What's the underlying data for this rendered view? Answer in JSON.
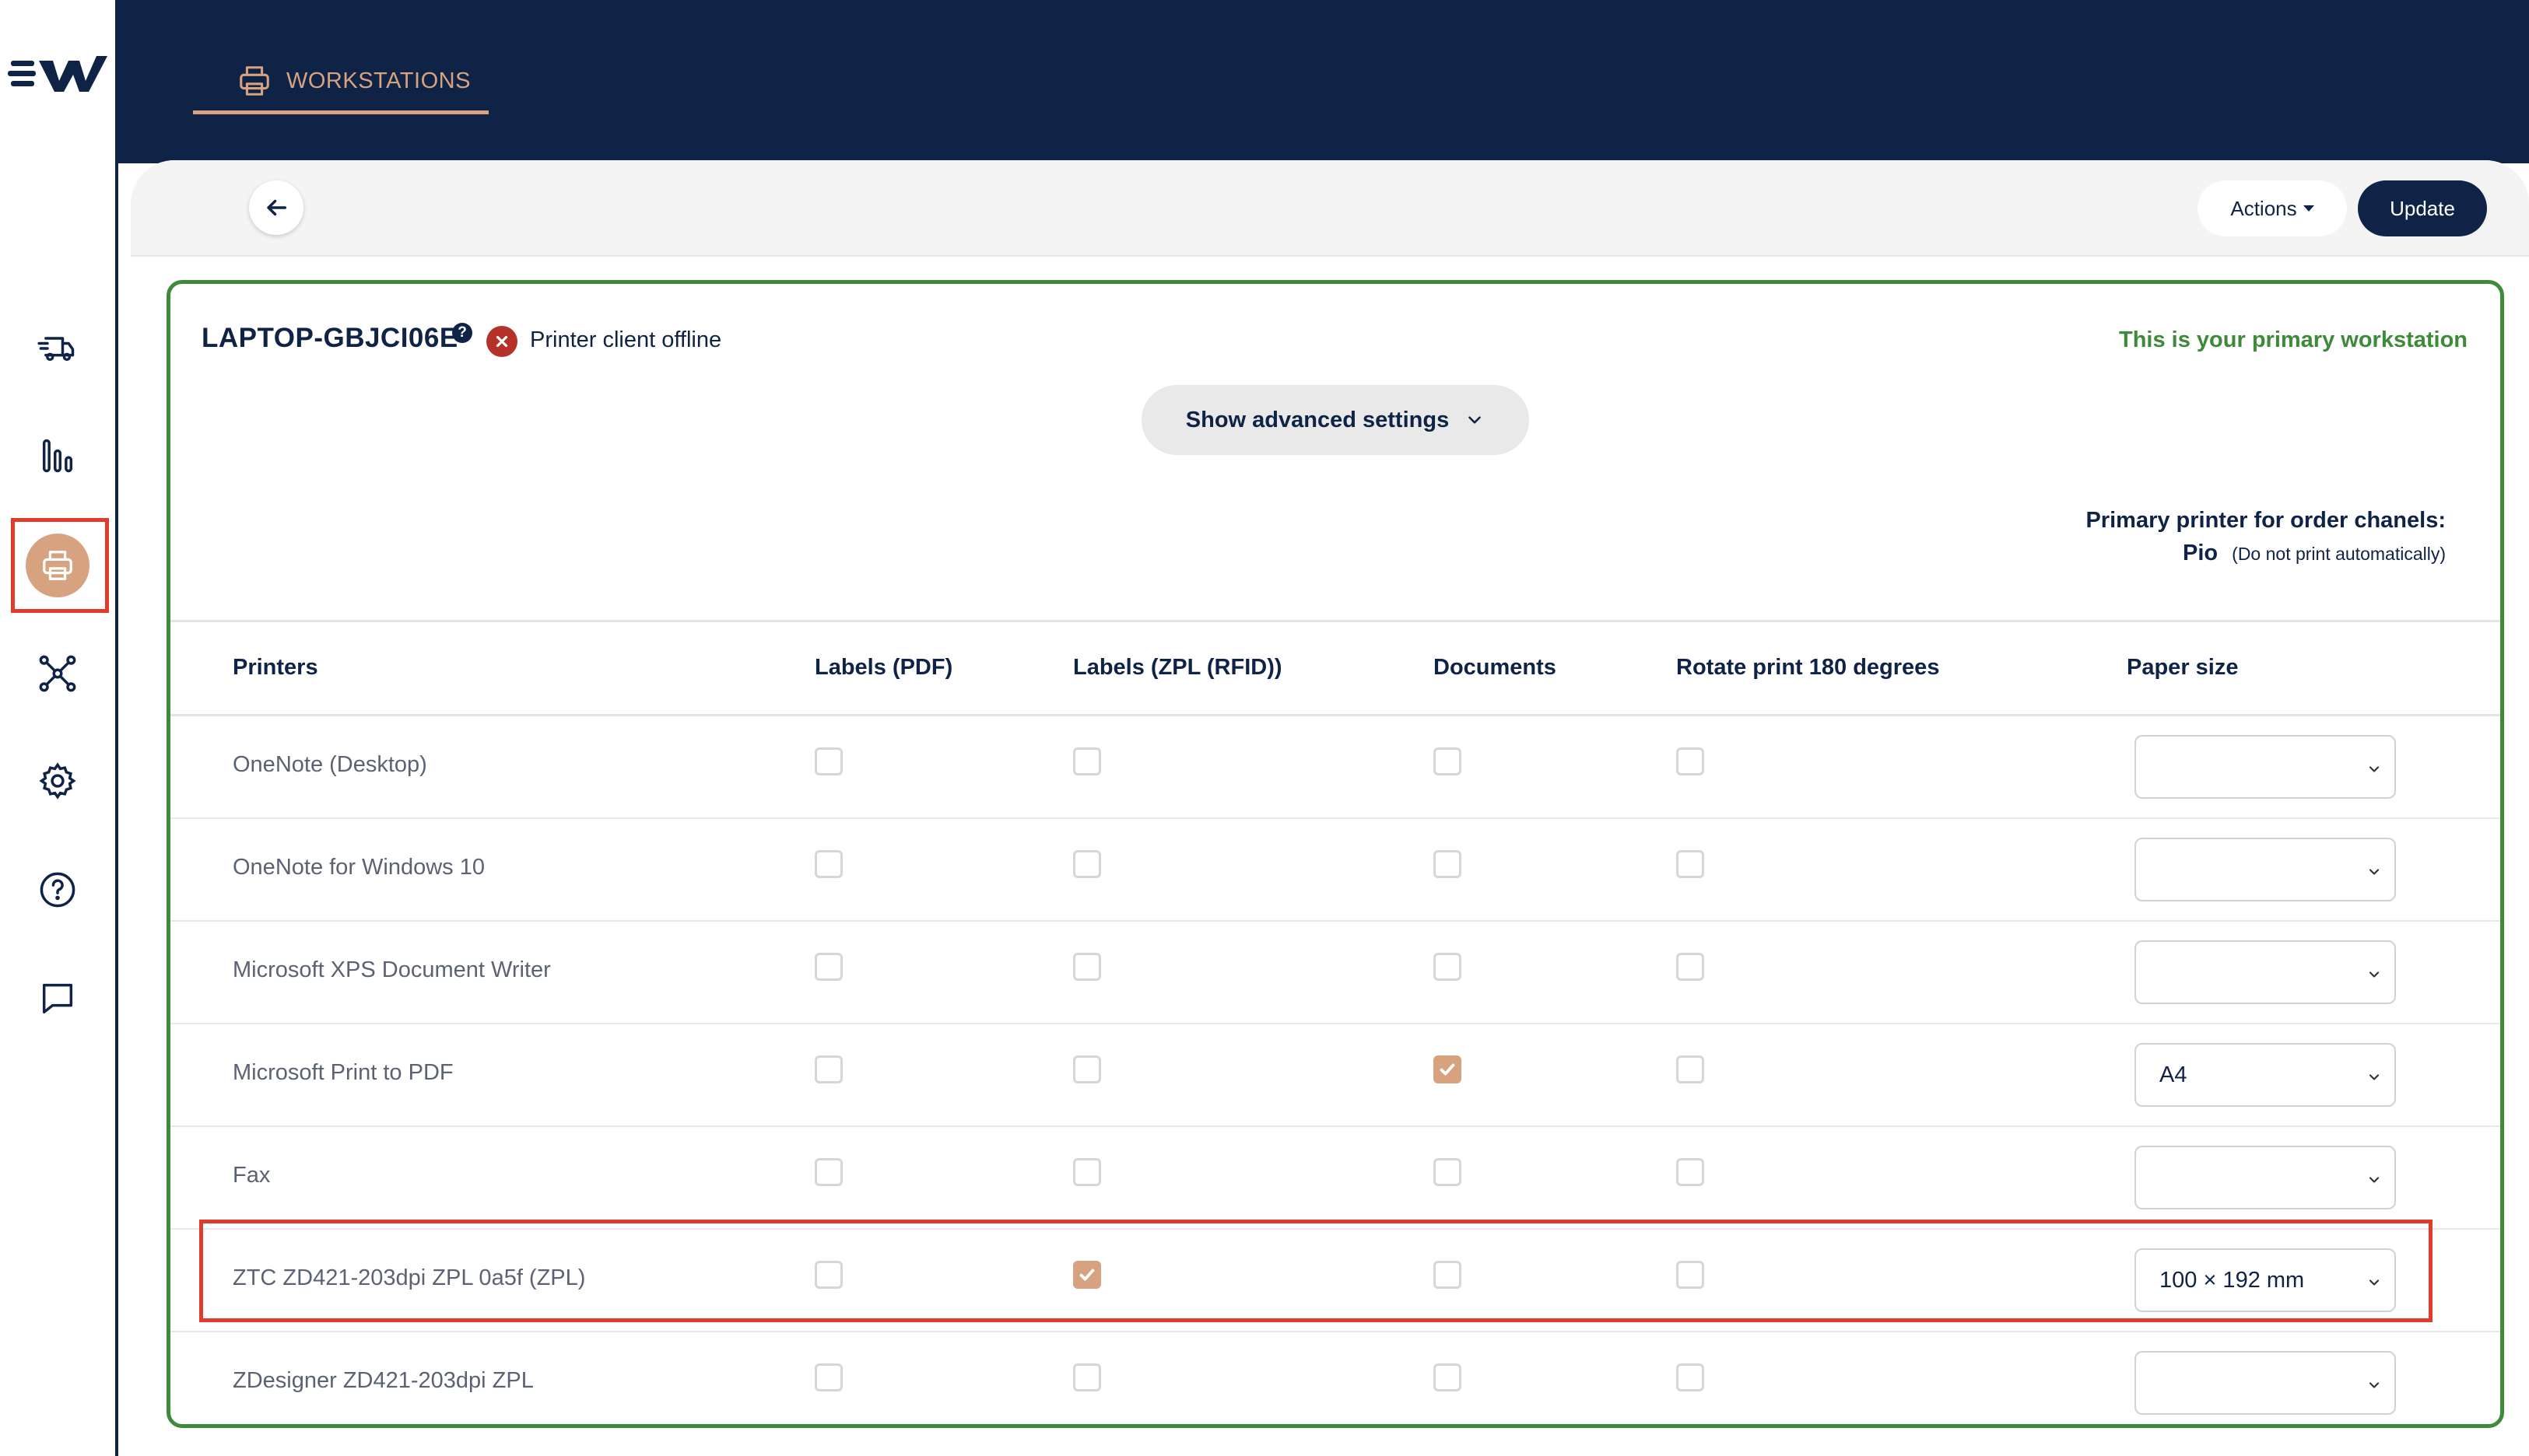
{
  "app": {
    "brand_icon": "logo-icon",
    "accent_color": "#d7a27f",
    "navy_color": "#0f2347",
    "success_color": "#3e8a3a"
  },
  "sidebar": {
    "items": [
      {
        "icon": "delivery-truck-icon"
      },
      {
        "icon": "bar-chart-icon"
      },
      {
        "icon": "printer-icon",
        "active": true
      },
      {
        "icon": "network-icon"
      },
      {
        "icon": "gear-icon"
      },
      {
        "icon": "help-icon"
      },
      {
        "icon": "chat-icon"
      }
    ]
  },
  "header": {
    "tab_label": "WORKSTATIONS",
    "tab_icon": "printer-icon"
  },
  "toolbar": {
    "back_icon": "arrow-left-icon",
    "actions_label": "Actions",
    "update_label": "Update"
  },
  "workstation": {
    "name": "LAPTOP-GBJCI06E",
    "help_glyph": "?",
    "status_text": "Printer client offline",
    "primary_text": "This is your primary workstation",
    "advanced_label": "Show advanced settings",
    "primary_printer_title": "Primary printer for order chanels:",
    "primary_channel": "Pio",
    "primary_note": "(Do not print automatically)"
  },
  "table": {
    "headers": {
      "printers": "Printers",
      "labels_pdf": "Labels (PDF)",
      "labels_zpl": "Labels (ZPL (RFID))",
      "documents": "Documents",
      "rotate": "Rotate print 180 degrees",
      "paper_size": "Paper size"
    },
    "rows": [
      {
        "name": "OneNote (Desktop)",
        "labels_pdf": false,
        "labels_zpl": false,
        "documents": false,
        "rotate": false,
        "paper_size": ""
      },
      {
        "name": "OneNote for Windows 10",
        "labels_pdf": false,
        "labels_zpl": false,
        "documents": false,
        "rotate": false,
        "paper_size": ""
      },
      {
        "name": "Microsoft XPS Document Writer",
        "labels_pdf": false,
        "labels_zpl": false,
        "documents": false,
        "rotate": false,
        "paper_size": ""
      },
      {
        "name": "Microsoft Print to PDF",
        "labels_pdf": false,
        "labels_zpl": false,
        "documents": true,
        "rotate": false,
        "paper_size": "A4"
      },
      {
        "name": "Fax",
        "labels_pdf": false,
        "labels_zpl": false,
        "documents": false,
        "rotate": false,
        "paper_size": ""
      },
      {
        "name": "ZTC ZD421-203dpi ZPL 0a5f (ZPL)",
        "labels_pdf": false,
        "labels_zpl": true,
        "documents": false,
        "rotate": false,
        "paper_size": "100 × 192 mm"
      },
      {
        "name": "ZDesigner ZD421-203dpi ZPL",
        "labels_pdf": false,
        "labels_zpl": false,
        "documents": false,
        "rotate": false,
        "paper_size": ""
      }
    ]
  }
}
